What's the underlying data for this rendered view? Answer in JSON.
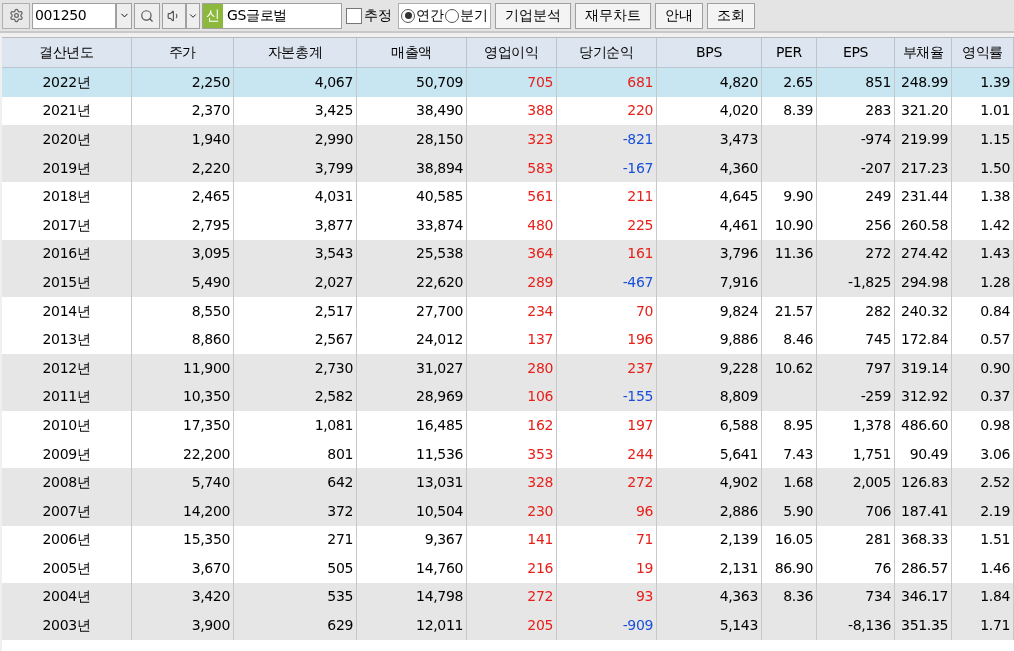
{
  "toolbar": {
    "code": "001250",
    "badge": "신",
    "name": "GS글로벌",
    "estimate": {
      "label": "추정",
      "checked": false
    },
    "periods": [
      {
        "label": "연간",
        "selected": true
      },
      {
        "label": "분기",
        "selected": false
      }
    ],
    "buttons": [
      "기업분석",
      "재무차트",
      "안내",
      "조회"
    ]
  },
  "table": {
    "columns": [
      "결산년도",
      "주가",
      "자본총계",
      "매출액",
      "영업이익",
      "당기순익",
      "BPS",
      "PER",
      "EPS",
      "부채율",
      "영익률"
    ],
    "rows": [
      {
        "selected": true,
        "net_negative": false,
        "cells": [
          "2022년",
          "2,250",
          "4,067",
          "50,709",
          "705",
          "681",
          "4,820",
          "2.65",
          "851",
          "248.99",
          "1.39"
        ]
      },
      {
        "selected": false,
        "net_negative": false,
        "cells": [
          "2021년",
          "2,370",
          "3,425",
          "38,490",
          "388",
          "220",
          "4,020",
          "8.39",
          "283",
          "321.20",
          "1.01"
        ]
      },
      {
        "selected": false,
        "net_negative": true,
        "cells": [
          "2020년",
          "1,940",
          "2,990",
          "28,150",
          "323",
          "-821",
          "3,473",
          "",
          "-974",
          "219.99",
          "1.15"
        ]
      },
      {
        "selected": false,
        "net_negative": true,
        "cells": [
          "2019년",
          "2,220",
          "3,799",
          "38,894",
          "583",
          "-167",
          "4,360",
          "",
          "-207",
          "217.23",
          "1.50"
        ]
      },
      {
        "selected": false,
        "net_negative": false,
        "cells": [
          "2018년",
          "2,465",
          "4,031",
          "40,585",
          "561",
          "211",
          "4,645",
          "9.90",
          "249",
          "231.44",
          "1.38"
        ]
      },
      {
        "selected": false,
        "net_negative": false,
        "cells": [
          "2017년",
          "2,795",
          "3,877",
          "33,874",
          "480",
          "225",
          "4,461",
          "10.90",
          "256",
          "260.58",
          "1.42"
        ]
      },
      {
        "selected": false,
        "net_negative": false,
        "cells": [
          "2016년",
          "3,095",
          "3,543",
          "25,538",
          "364",
          "161",
          "3,796",
          "11.36",
          "272",
          "274.42",
          "1.43"
        ]
      },
      {
        "selected": false,
        "net_negative": true,
        "cells": [
          "2015년",
          "5,490",
          "2,027",
          "22,620",
          "289",
          "-467",
          "7,916",
          "",
          "-1,825",
          "294.98",
          "1.28"
        ]
      },
      {
        "selected": false,
        "net_negative": false,
        "cells": [
          "2014년",
          "8,550",
          "2,517",
          "27,700",
          "234",
          "70",
          "9,824",
          "21.57",
          "282",
          "240.32",
          "0.84"
        ]
      },
      {
        "selected": false,
        "net_negative": false,
        "cells": [
          "2013년",
          "8,860",
          "2,567",
          "24,012",
          "137",
          "196",
          "9,886",
          "8.46",
          "745",
          "172.84",
          "0.57"
        ]
      },
      {
        "selected": false,
        "net_negative": false,
        "cells": [
          "2012년",
          "11,900",
          "2,730",
          "31,027",
          "280",
          "237",
          "9,228",
          "10.62",
          "797",
          "319.14",
          "0.90"
        ]
      },
      {
        "selected": false,
        "net_negative": true,
        "cells": [
          "2011년",
          "10,350",
          "2,582",
          "28,969",
          "106",
          "-155",
          "8,809",
          "",
          "-259",
          "312.92",
          "0.37"
        ]
      },
      {
        "selected": false,
        "net_negative": false,
        "cells": [
          "2010년",
          "17,350",
          "1,081",
          "16,485",
          "162",
          "197",
          "6,588",
          "8.95",
          "1,378",
          "486.60",
          "0.98"
        ]
      },
      {
        "selected": false,
        "net_negative": false,
        "cells": [
          "2009년",
          "22,200",
          "801",
          "11,536",
          "353",
          "244",
          "5,641",
          "7.43",
          "1,751",
          "90.49",
          "3.06"
        ]
      },
      {
        "selected": false,
        "net_negative": false,
        "cells": [
          "2008년",
          "5,740",
          "642",
          "13,031",
          "328",
          "272",
          "4,902",
          "1.68",
          "2,005",
          "126.83",
          "2.52"
        ]
      },
      {
        "selected": false,
        "net_negative": false,
        "cells": [
          "2007년",
          "14,200",
          "372",
          "10,504",
          "230",
          "96",
          "2,886",
          "5.90",
          "706",
          "187.41",
          "2.19"
        ]
      },
      {
        "selected": false,
        "net_negative": false,
        "cells": [
          "2006년",
          "15,350",
          "271",
          "9,367",
          "141",
          "71",
          "2,139",
          "16.05",
          "281",
          "368.33",
          "1.51"
        ]
      },
      {
        "selected": false,
        "net_negative": false,
        "cells": [
          "2005년",
          "3,670",
          "505",
          "14,760",
          "216",
          "19",
          "2,131",
          "86.90",
          "76",
          "286.57",
          "1.46"
        ]
      },
      {
        "selected": false,
        "net_negative": false,
        "cells": [
          "2004년",
          "3,420",
          "535",
          "14,798",
          "272",
          "93",
          "4,363",
          "8.36",
          "734",
          "346.17",
          "1.84"
        ]
      },
      {
        "selected": false,
        "net_negative": true,
        "cells": [
          "2003년",
          "3,900",
          "629",
          "12,011",
          "205",
          "-909",
          "5,143",
          "",
          "-8,136",
          "351.35",
          "1.71"
        ]
      }
    ]
  }
}
